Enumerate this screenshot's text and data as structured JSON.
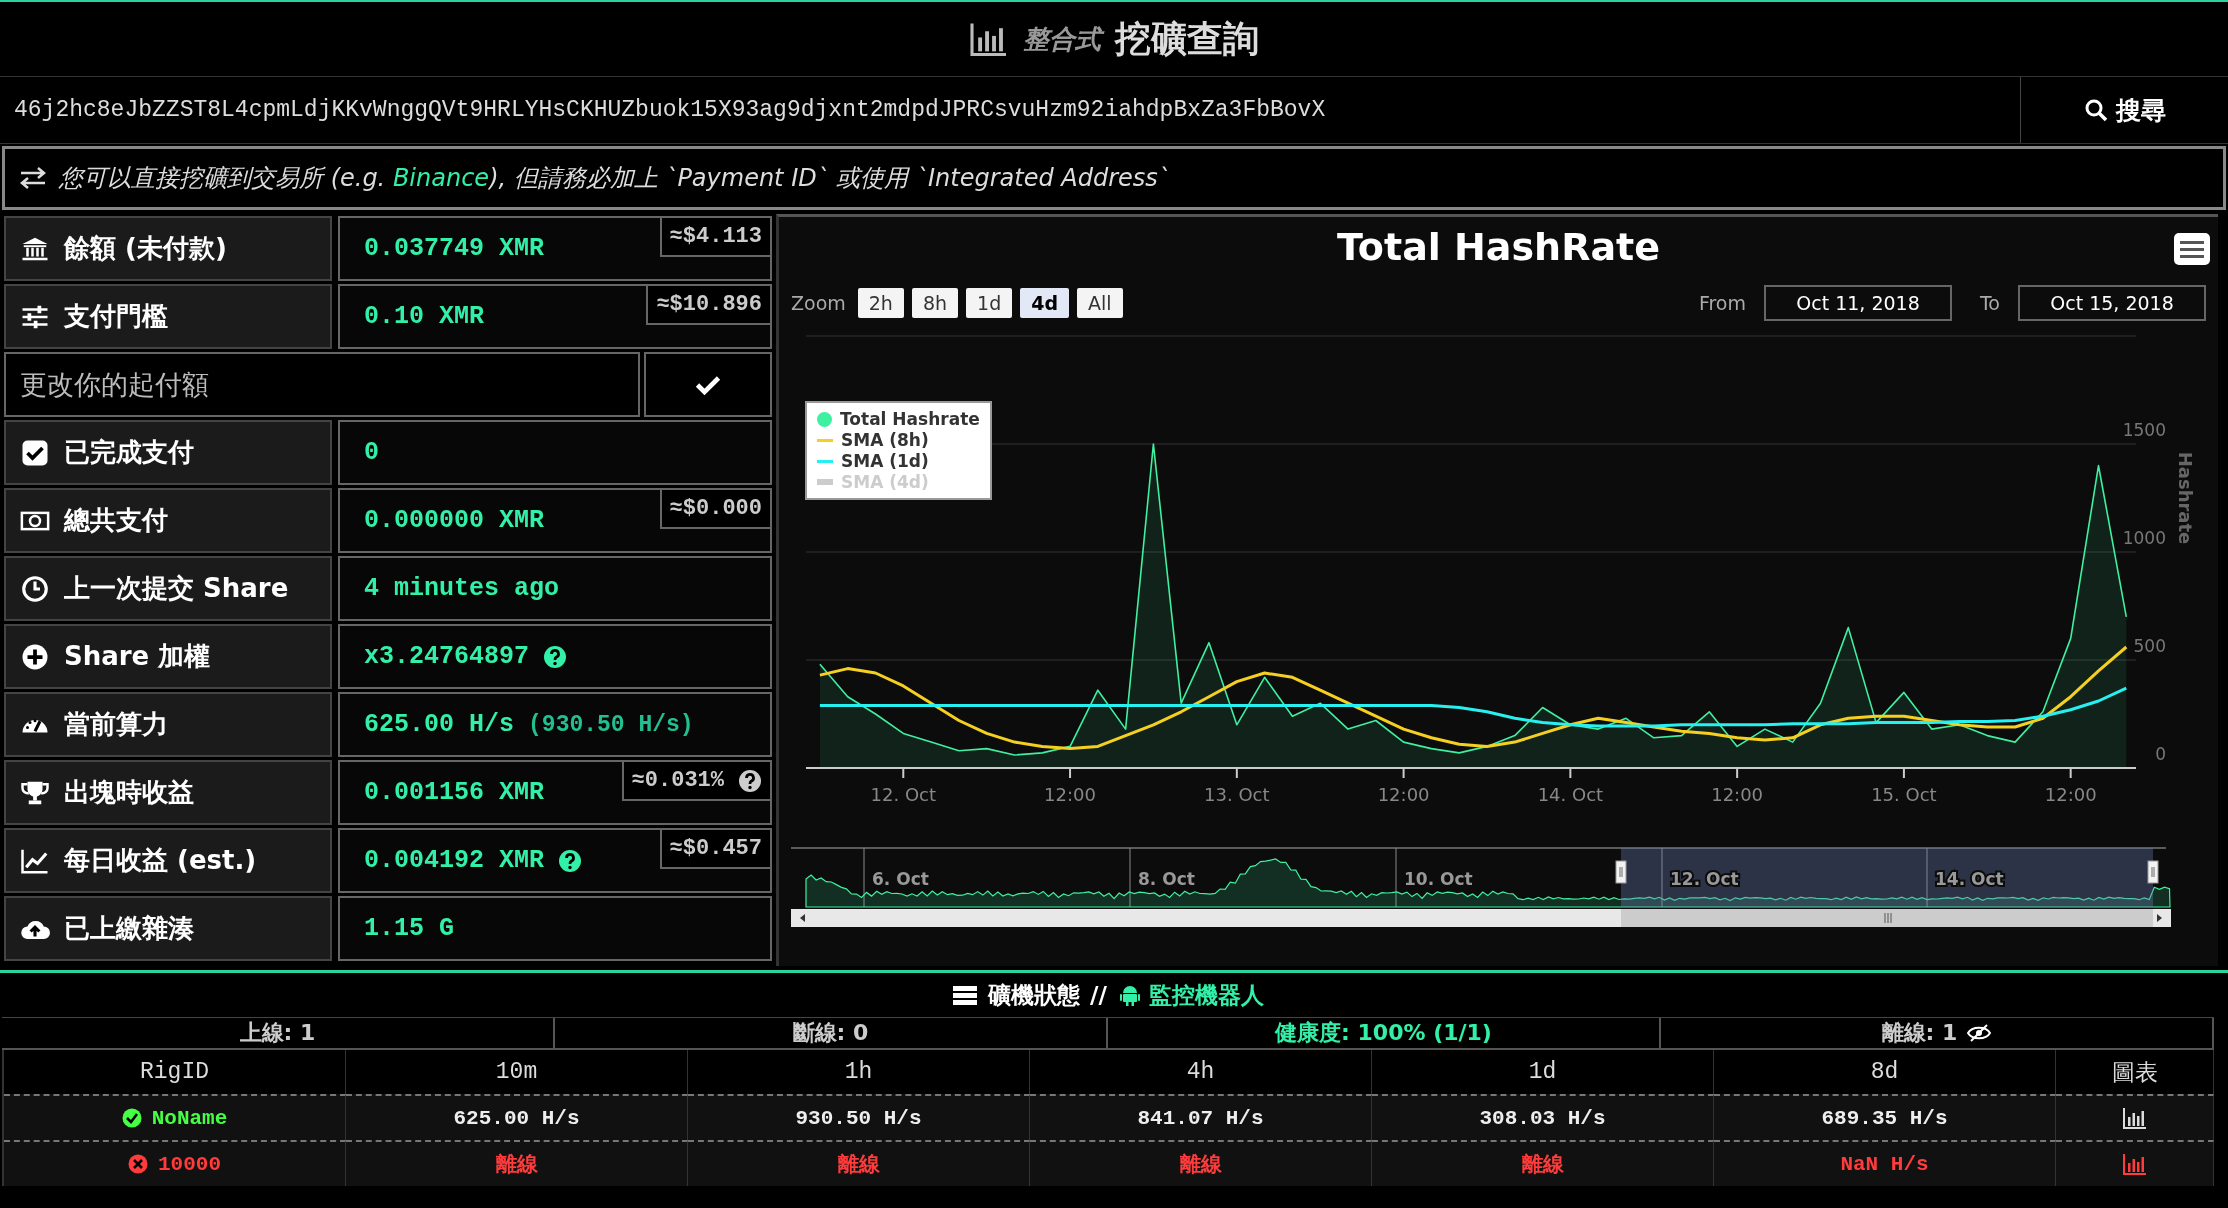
{
  "header": {
    "title_prefix": "整合式",
    "title": "挖礦查詢"
  },
  "search": {
    "value": "46j2hc8eJbZZST8L4cpmLdjKKvWnggQVt9HRLYHsCKHUZbuok15X93ag9djxnt2mdpdJPRCsvuHzm92iahdpBxZa3FbBovX",
    "button": "搜尋"
  },
  "notice": {
    "before": "您可以直接挖礦到交易所 (e.g. ",
    "link": "Binance",
    "after": "), 但請務必加上 `Payment ID` 或使用 `Integrated Address`"
  },
  "stats": [
    {
      "kind": "stat",
      "label": "餘額 (未付款)",
      "value": "0.037749 XMR",
      "badge": "≈$4.113"
    },
    {
      "kind": "stat",
      "label": "支付門檻",
      "value": "0.10 XMR",
      "badge": "≈$10.896"
    },
    {
      "kind": "input",
      "placeholder": "更改你的起付額"
    },
    {
      "kind": "stat",
      "label": "已完成支付",
      "value": "0"
    },
    {
      "kind": "stat",
      "label": "總共支付",
      "value": "0.000000 XMR",
      "badge": "≈$0.000"
    },
    {
      "kind": "stat",
      "label": "上一次提交 Share",
      "value": "4 minutes ago"
    },
    {
      "kind": "stat",
      "label": "Share 加權",
      "value": "x3.24764897",
      "help": true
    },
    {
      "kind": "stat",
      "label": "當前算力",
      "value": "625.00 H/s",
      "sub": "(930.50 H/s)"
    },
    {
      "kind": "stat",
      "label": "出塊時收益",
      "value": "0.001156 XMR",
      "badge": "≈0.031%",
      "badge_help": true
    },
    {
      "kind": "stat",
      "label": "每日收益 (est.)",
      "value": "0.004192 XMR",
      "badge": "≈$0.457",
      "help": true
    },
    {
      "kind": "stat",
      "label": "已上繳雜湊",
      "value": "1.15 G"
    }
  ],
  "chart": {
    "title": "Total HashRate",
    "zoom_label": "Zoom",
    "ranges": [
      {
        "label": "2h",
        "selected": false
      },
      {
        "label": "8h",
        "selected": false
      },
      {
        "label": "1d",
        "selected": false
      },
      {
        "label": "4d",
        "selected": true
      },
      {
        "label": "All",
        "selected": false
      }
    ],
    "from_label": "From",
    "from": "Oct 11, 2018",
    "to_label": "To",
    "to": "Oct 15, 2018",
    "extra_legend_items": [
      {
        "label": "SMA (4d)",
        "hidden": true
      }
    ],
    "navigator_labels": [
      "6. Oct",
      "8. Oct",
      "10. Oct",
      "12. Oct",
      "14. Oct"
    ],
    "chart_data": {
      "type": "line",
      "ylabel": "Hashrate",
      "ylim": [
        0,
        2000
      ],
      "grid": true,
      "legend": true,
      "categories": [
        null,
        null,
        null,
        "12. Oct",
        null,
        null,
        null,
        null,
        null,
        "12:00",
        null,
        null,
        null,
        null,
        null,
        "13. Oct",
        null,
        null,
        null,
        null,
        null,
        "12:00",
        null,
        null,
        null,
        null,
        null,
        "14. Oct",
        null,
        null,
        null,
        null,
        null,
        "12:00",
        null,
        null,
        null,
        null,
        null,
        "15. Oct",
        null,
        null,
        null,
        null,
        null,
        "12:00",
        null,
        null
      ],
      "yticks": [
        0,
        500,
        1000,
        1500
      ],
      "series": [
        {
          "name": "Total Hashrate",
          "type": "area",
          "color": "#3ef0a0",
          "values": [
            480,
            330,
            250,
            160,
            120,
            80,
            90,
            60,
            70,
            100,
            360,
            180,
            1500,
            300,
            580,
            200,
            420,
            240,
            300,
            180,
            220,
            120,
            90,
            70,
            100,
            150,
            280,
            200,
            180,
            230,
            140,
            150,
            260,
            100,
            180,
            120,
            300,
            650,
            210,
            350,
            180,
            200,
            150,
            120,
            260,
            600,
            1400,
            700
          ]
        },
        {
          "name": "SMA (8h)",
          "color": "#f5d020",
          "values": [
            430,
            460,
            440,
            380,
            300,
            220,
            160,
            120,
            100,
            90,
            100,
            150,
            200,
            260,
            330,
            400,
            440,
            420,
            360,
            300,
            240,
            180,
            140,
            110,
            100,
            120,
            160,
            200,
            230,
            210,
            190,
            170,
            160,
            140,
            130,
            140,
            200,
            230,
            240,
            240,
            220,
            200,
            190,
            190,
            230,
            330,
            450,
            560
          ]
        },
        {
          "name": "SMA (1d)",
          "color": "#27f0f0",
          "values": [
            290,
            290,
            290,
            290,
            290,
            290,
            290,
            290,
            290,
            290,
            290,
            290,
            290,
            290,
            290,
            290,
            290,
            290,
            290,
            290,
            290,
            290,
            290,
            280,
            260,
            230,
            210,
            200,
            195,
            195,
            195,
            200,
            200,
            200,
            200,
            205,
            205,
            205,
            210,
            210,
            210,
            215,
            215,
            220,
            240,
            270,
            310,
            370
          ]
        }
      ]
    }
  },
  "rigs": {
    "title": "礦機狀態",
    "separator": "//",
    "link": "監控機器人",
    "summary": [
      {
        "kind": "count",
        "label": "上線: 1"
      },
      {
        "kind": "count",
        "label": "斷線: 0"
      },
      {
        "kind": "health",
        "label": "健康度: 100% (1/1)"
      },
      {
        "kind": "offline",
        "label": "離線: 1"
      }
    ],
    "columns": [
      "RigID",
      "10m",
      "1h",
      "4h",
      "1d",
      "8d",
      "圖表"
    ],
    "rows": [
      {
        "online": true,
        "cells": [
          "NoName",
          "625.00 H/s",
          "930.50 H/s",
          "841.07 H/s",
          "308.03 H/s",
          "689.35 H/s"
        ]
      },
      {
        "online": false,
        "cells": [
          "10000",
          "離線",
          "離線",
          "離線",
          "離線",
          "NaN H/s"
        ]
      }
    ]
  }
}
